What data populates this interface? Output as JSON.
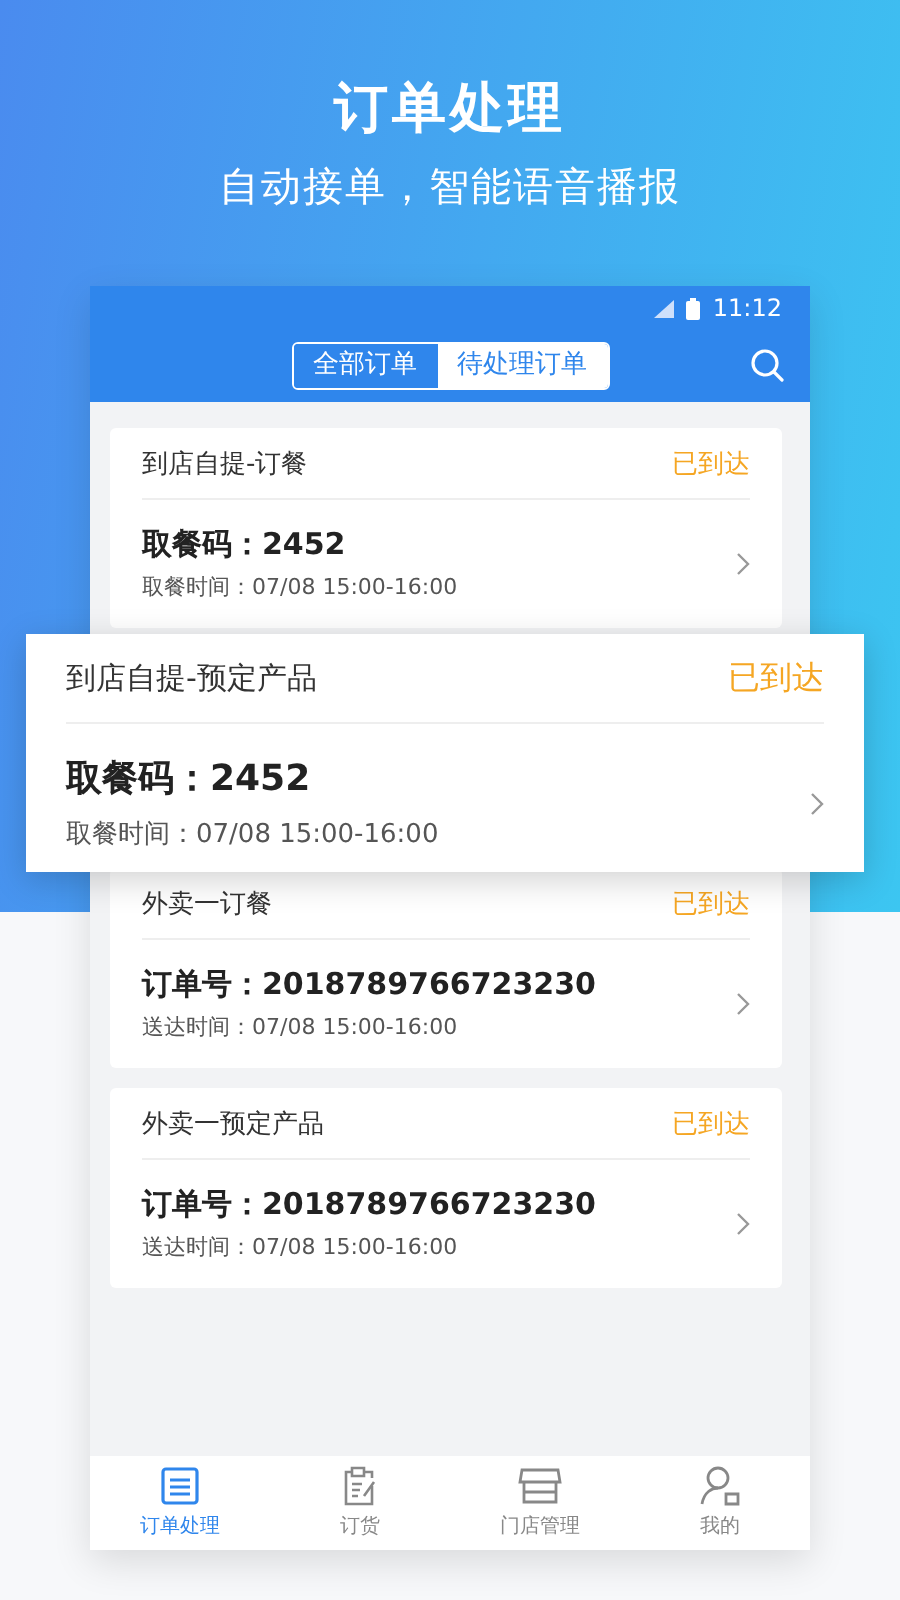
{
  "promo": {
    "title": "订单处理",
    "subtitle": "自动接单，智能语音播报"
  },
  "status_bar": {
    "time": "11:12"
  },
  "tabs": [
    {
      "label": "全部订单",
      "selected": false
    },
    {
      "label": "待处理订单",
      "selected": true
    }
  ],
  "orders": [
    {
      "type": "到店自提-订餐",
      "status": "已到达",
      "code": "取餐码：2452",
      "time": "取餐时间：07/08 15:00-16:00",
      "highlighted": false
    },
    {
      "type": "到店自提-预定产品",
      "status": "已到达",
      "code": "取餐码：2452",
      "time": "取餐时间：07/08 15:00-16:00",
      "highlighted": true
    },
    {
      "type": "外卖一订餐",
      "status": "已到达",
      "code": "订单号：2018789766723230",
      "time": "送达时间：07/08 15:00-16:00",
      "highlighted": false
    },
    {
      "type": "外卖一预定产品",
      "status": "已到达",
      "code": "订单号：2018789766723230",
      "time": "送达时间：07/08 15:00-16:00",
      "highlighted": false
    }
  ],
  "nav": [
    {
      "label": "订单处理",
      "kind": "orders",
      "selected": true
    },
    {
      "label": "订货",
      "kind": "purchase",
      "selected": false
    },
    {
      "label": "门店管理",
      "kind": "store",
      "selected": false
    },
    {
      "label": "我的",
      "kind": "profile",
      "selected": false
    }
  ]
}
